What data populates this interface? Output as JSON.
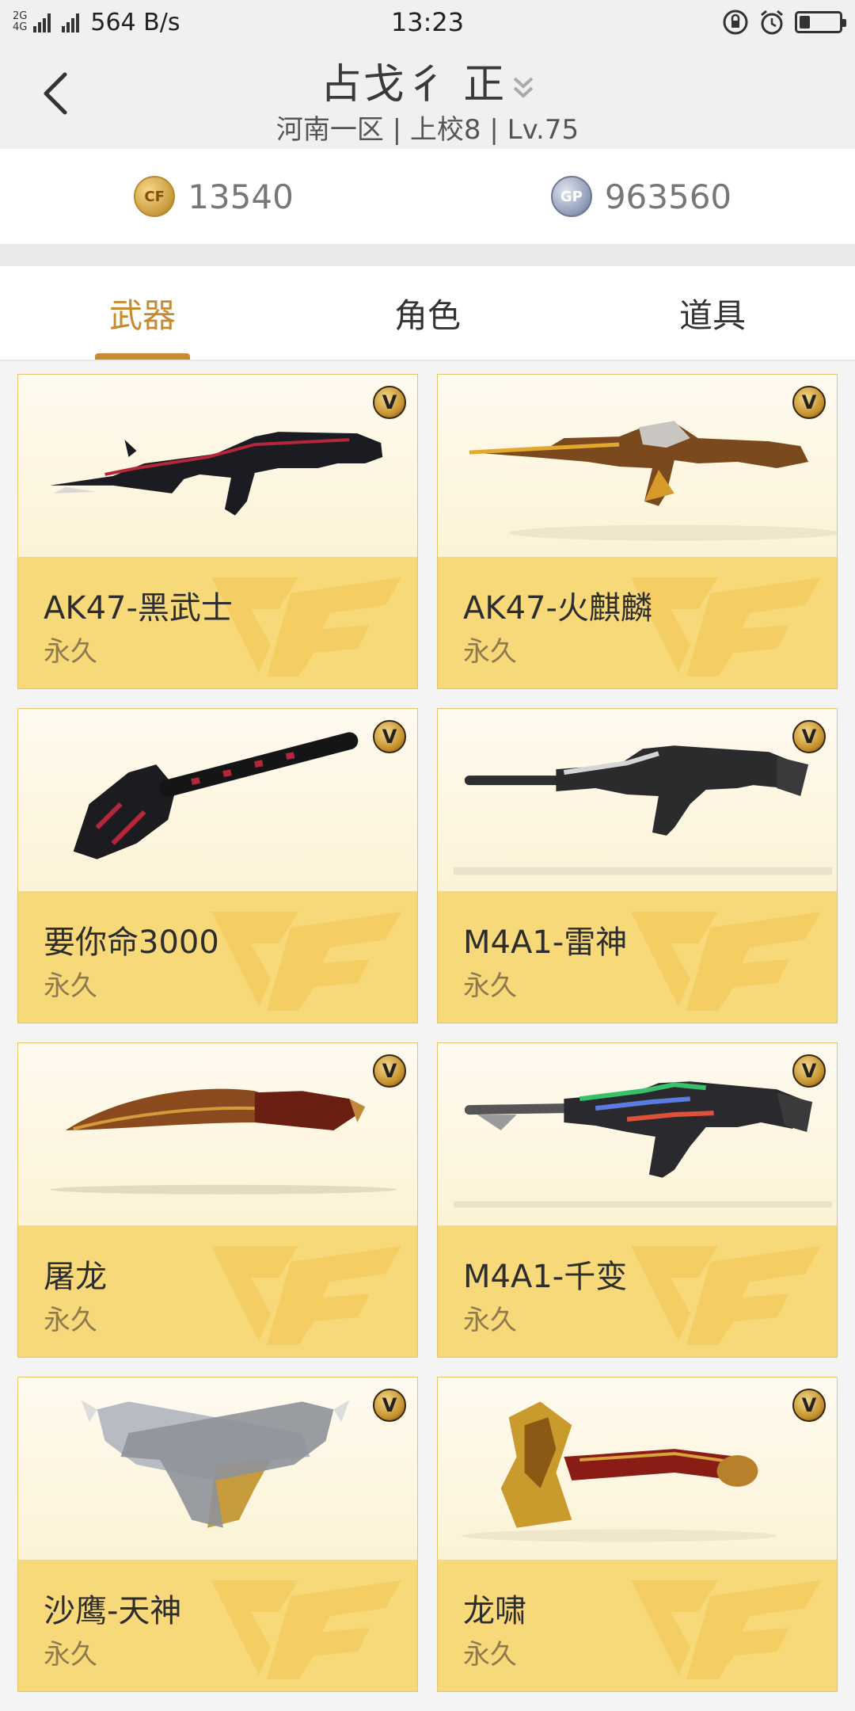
{
  "status_bar": {
    "net_top": "2G",
    "net_bottom": "4G",
    "speed": "564 B/s",
    "time": "13:23"
  },
  "header": {
    "title": "占戈彳 正",
    "subtitle": "河南一区 | 上校8 | Lv.75"
  },
  "currency": {
    "cf_label": "CF",
    "cf_value": "13540",
    "gp_label": "GP",
    "gp_value": "963560"
  },
  "tabs": [
    {
      "label": "武器",
      "active": true
    },
    {
      "label": "角色",
      "active": false
    },
    {
      "label": "道具",
      "active": false
    }
  ],
  "items": [
    {
      "name": "AK47-黑武士",
      "duration": "永久",
      "badge": "V",
      "icon": "rifle-black-icon"
    },
    {
      "name": "AK47-火麒麟",
      "duration": "永久",
      "badge": "V",
      "icon": "rifle-gold-icon"
    },
    {
      "name": "要你命3000",
      "duration": "永久",
      "badge": "V",
      "icon": "shovel-icon"
    },
    {
      "name": "M4A1-雷神",
      "duration": "永久",
      "badge": "V",
      "icon": "rifle-silver-icon"
    },
    {
      "name": "屠龙",
      "duration": "永久",
      "badge": "V",
      "icon": "machete-icon"
    },
    {
      "name": "M4A1-千变",
      "duration": "永久",
      "badge": "V",
      "icon": "rifle-rainbow-icon"
    },
    {
      "name": "沙鹰-天神",
      "duration": "永久",
      "badge": "V",
      "icon": "dual-pistol-icon"
    },
    {
      "name": "龙啸",
      "duration": "永久",
      "badge": "V",
      "icon": "dragon-axe-icon"
    }
  ],
  "colors": {
    "accent": "#c88a2e",
    "card_bottom": "#f8d97a",
    "card_top": "#fdf6e0"
  }
}
